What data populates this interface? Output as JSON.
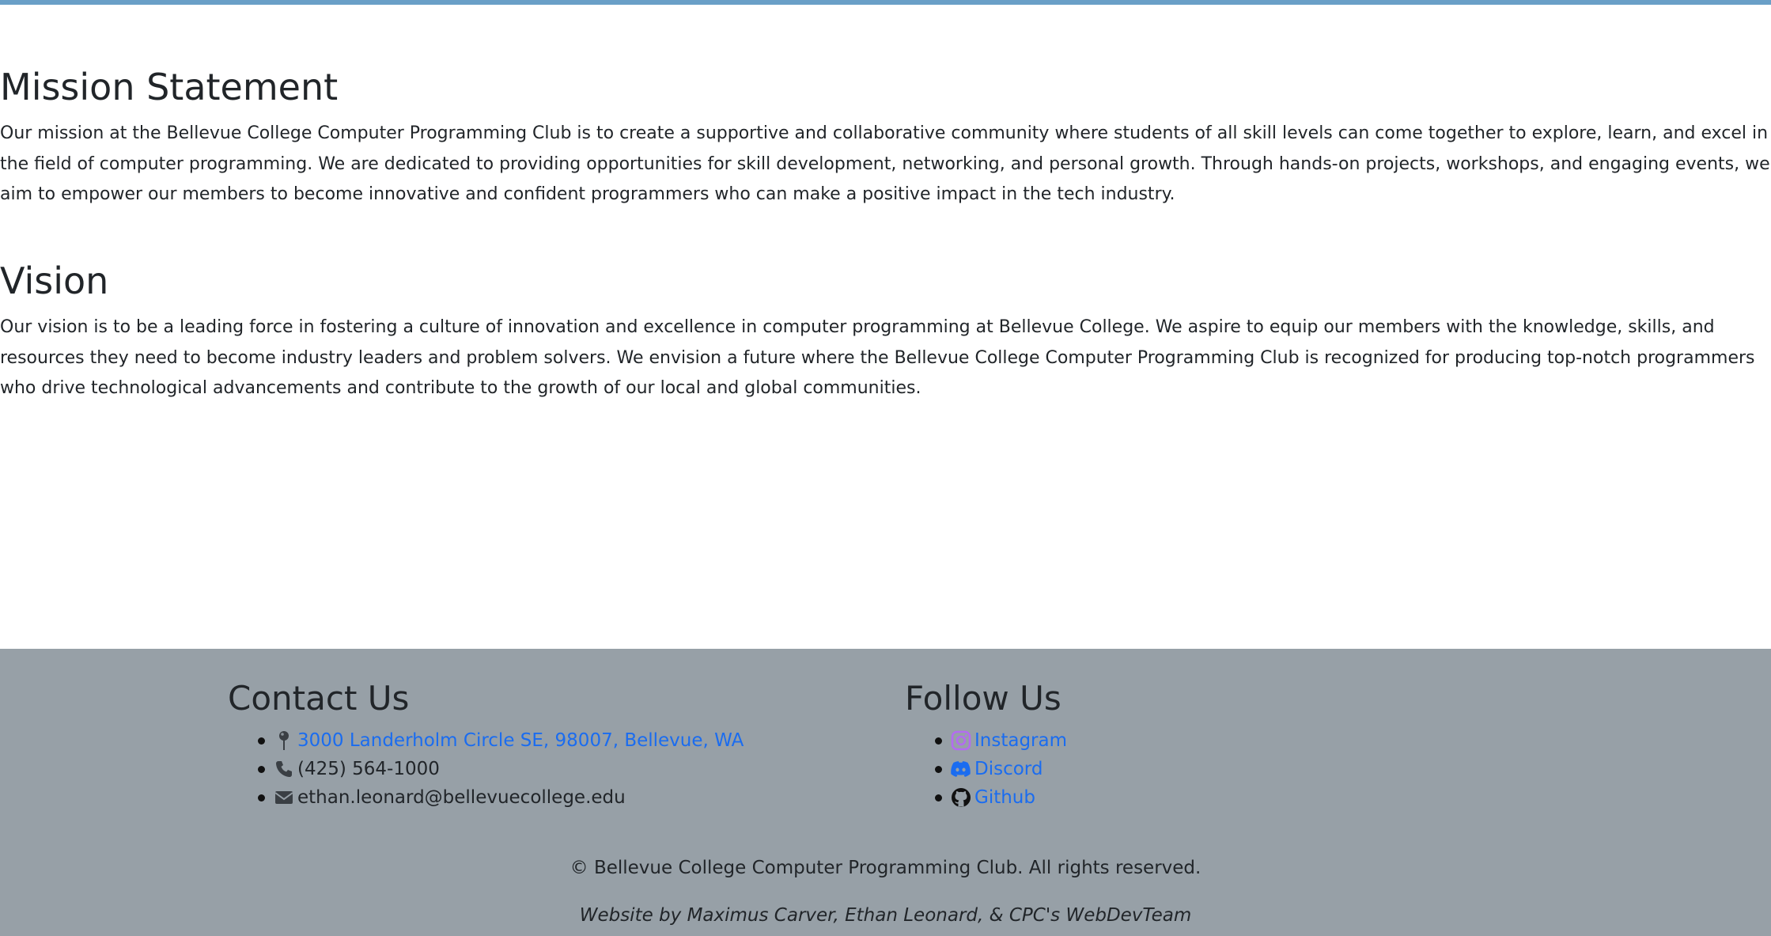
{
  "colors": {
    "accent_bar": "#6a9fc7",
    "footer_bg": "#97a0a7",
    "link": "#1a6cf0",
    "instagram_icon": "#b36cf0"
  },
  "mission": {
    "title": "Mission Statement",
    "text": "Our mission at the Bellevue College Computer Programming Club is to create a supportive and collaborative community where students of all skill levels can come together to explore, learn, and excel in the field of computer programming. We are dedicated to providing opportunities for skill development, networking, and personal growth. Through hands-on projects, workshops, and engaging events, we aim to empower our members to become innovative and confident programmers who can make a positive impact in the tech industry."
  },
  "vision": {
    "title": "Vision",
    "text": "Our vision is to be a leading force in fostering a culture of innovation and excellence in computer programming at Bellevue College. We aspire to equip our members with the knowledge, skills, and resources they need to become industry leaders and problem solvers. We envision a future where the Bellevue College Computer Programming Club is recognized for producing top-notch programmers who drive technological advancements and contribute to the growth of our local and global communities."
  },
  "footer": {
    "contact": {
      "heading": "Contact Us",
      "items": [
        {
          "icon": "map-pin-icon",
          "text": "3000 Landerholm Circle SE, 98007, Bellevue, WA"
        },
        {
          "icon": "phone-icon",
          "text": "(425) 564-1000"
        },
        {
          "icon": "envelope-icon",
          "text": "ethan.leonard@bellevuecollege.edu"
        }
      ]
    },
    "follow": {
      "heading": "Follow Us",
      "items": [
        {
          "icon": "instagram-icon",
          "text": "Instagram"
        },
        {
          "icon": "discord-icon",
          "text": "Discord"
        },
        {
          "icon": "github-icon",
          "text": "Github"
        }
      ]
    },
    "copyright": "© Bellevue College Computer Programming Club. All rights reserved.",
    "credits": "Website by Maximus Carver, Ethan Leonard, & CPC's WebDevTeam"
  }
}
